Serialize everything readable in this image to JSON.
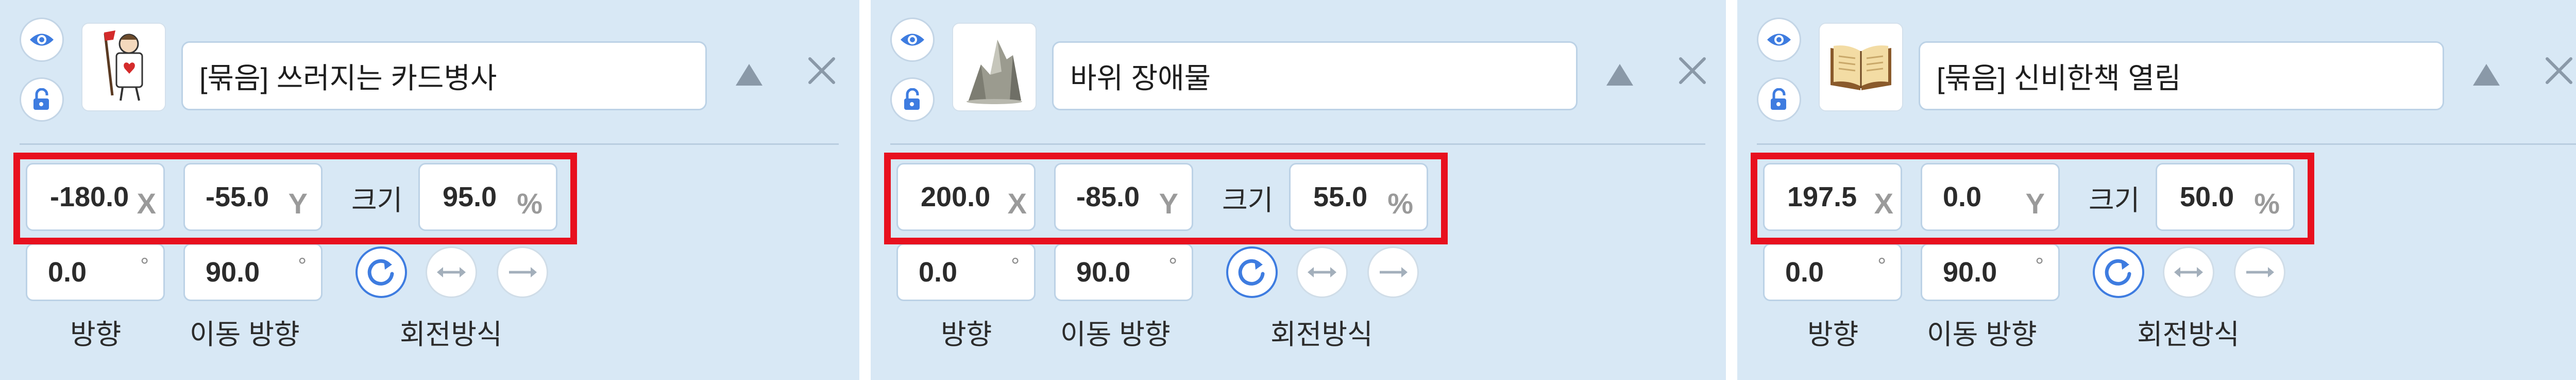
{
  "panels": [
    {
      "name": "[묶음] 쓰러지는 카드병사",
      "x": "-180.0",
      "y": "-55.0",
      "size": "95.0",
      "direction": "0.0",
      "move_direction": "90.0"
    },
    {
      "name": "바위 장애물",
      "x": "200.0",
      "y": "-85.0",
      "size": "55.0",
      "direction": "0.0",
      "move_direction": "90.0"
    },
    {
      "name": "[묶음] 신비한책 열림",
      "x": "197.5",
      "y": "0.0",
      "size": "50.0",
      "direction": "0.0",
      "move_direction": "90.0"
    }
  ],
  "labels": {
    "x_unit": "X",
    "y_unit": "Y",
    "size_label": "크기",
    "size_unit": "%",
    "degree_unit": "°",
    "direction_label": "방향",
    "move_direction_label": "이동 방향",
    "rotation_label": "회전방식"
  },
  "colors": {
    "panel_bg": "#d8e8f5",
    "accent_blue": "#3e7ce0",
    "highlight_red": "#e8101e"
  },
  "icons": [
    "eye-icon",
    "lock-open-icon",
    "arrow-up-icon",
    "close-icon",
    "rotate-icon",
    "flip-horizontal-icon",
    "no-rotate-icon"
  ]
}
